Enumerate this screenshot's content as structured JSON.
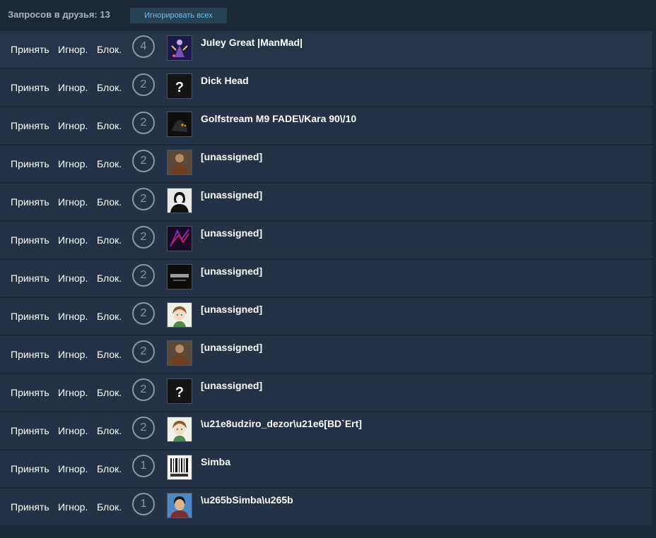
{
  "header": {
    "count_label": "Запросов в друзья: 13",
    "ignore_all_label": "Игнорировать всех"
  },
  "actions": {
    "accept": "Принять",
    "ignore": "Игнор.",
    "block": "Блок."
  },
  "requests": [
    {
      "badge": "4",
      "name": "Juley Great |ManMad|",
      "avatar": "fantasy-figure-icon"
    },
    {
      "badge": "2",
      "name": "Dick Head",
      "avatar": "question-mark-icon"
    },
    {
      "badge": "2",
      "name": "Golfstream M9 FADE\\/Kara 90\\/10",
      "avatar": "dark-creature-icon"
    },
    {
      "badge": "2",
      "name": "[unassigned]",
      "avatar": "person-photo-icon"
    },
    {
      "badge": "2",
      "name": "[unassigned]",
      "avatar": "bw-portrait-icon"
    },
    {
      "badge": "2",
      "name": "[unassigned]",
      "avatar": "envy-logo-icon"
    },
    {
      "badge": "2",
      "name": "[unassigned]",
      "avatar": "squad-logo-icon"
    },
    {
      "badge": "2",
      "name": "[unassigned]",
      "avatar": "anime-character-icon"
    },
    {
      "badge": "2",
      "name": "[unassigned]",
      "avatar": "person-photo-icon"
    },
    {
      "badge": "2",
      "name": "[unassigned]",
      "avatar": "question-mark-icon"
    },
    {
      "badge": "2",
      "name": "\\u21e8udziro_dezor\\u21e6[BD`Ert]",
      "avatar": "anime-character-icon"
    },
    {
      "badge": "1",
      "name": "Simba",
      "avatar": "barcode-logo-icon"
    },
    {
      "badge": "1",
      "name": "\\u265bSimba\\u265b",
      "avatar": "child-photo-icon"
    }
  ]
}
